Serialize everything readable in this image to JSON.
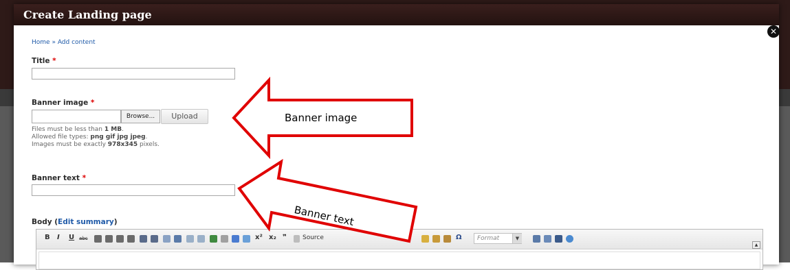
{
  "dialog": {
    "title": "Create Landing page"
  },
  "breadcrumb": {
    "home": "Home",
    "separator": " » ",
    "current": "Add content"
  },
  "fields": {
    "title": {
      "label": "Title",
      "required_marker": "*",
      "value": ""
    },
    "banner_image": {
      "label": "Banner image",
      "required_marker": "*",
      "browse_label": "Browse...",
      "upload_label": "Upload",
      "desc_size_prefix": "Files must be less than ",
      "desc_size_value": "1 MB",
      "desc_size_suffix": ".",
      "desc_types_prefix": "Allowed file types: ",
      "desc_types_value": "png gif jpg jpeg",
      "desc_types_suffix": ".",
      "desc_dims_prefix": "Images must be exactly ",
      "desc_dims_value": "978x345",
      "desc_dims_suffix": " pixels."
    },
    "banner_text": {
      "label": "Banner text",
      "required_marker": "*",
      "value": ""
    },
    "body": {
      "label": "Body",
      "edit_summary_link": "Edit summary"
    }
  },
  "editor_toolbar": {
    "bold": "B",
    "italic": "I",
    "underline": "U",
    "strike": "abc",
    "superscript": "x²",
    "subscript": "x₂",
    "blockquote": "❞",
    "source": "Source",
    "special_char": "Ω",
    "format_placeholder": "Format",
    "format_arrow": "▼",
    "collapse": "▲"
  },
  "annotations": {
    "banner_image_callout": "Banner image",
    "banner_text_callout": "Banner text",
    "arrow_color": "#e00000"
  },
  "colors": {
    "title_bar": "#2e1a18",
    "link": "#1f5aa8",
    "required": "#dd0000"
  }
}
